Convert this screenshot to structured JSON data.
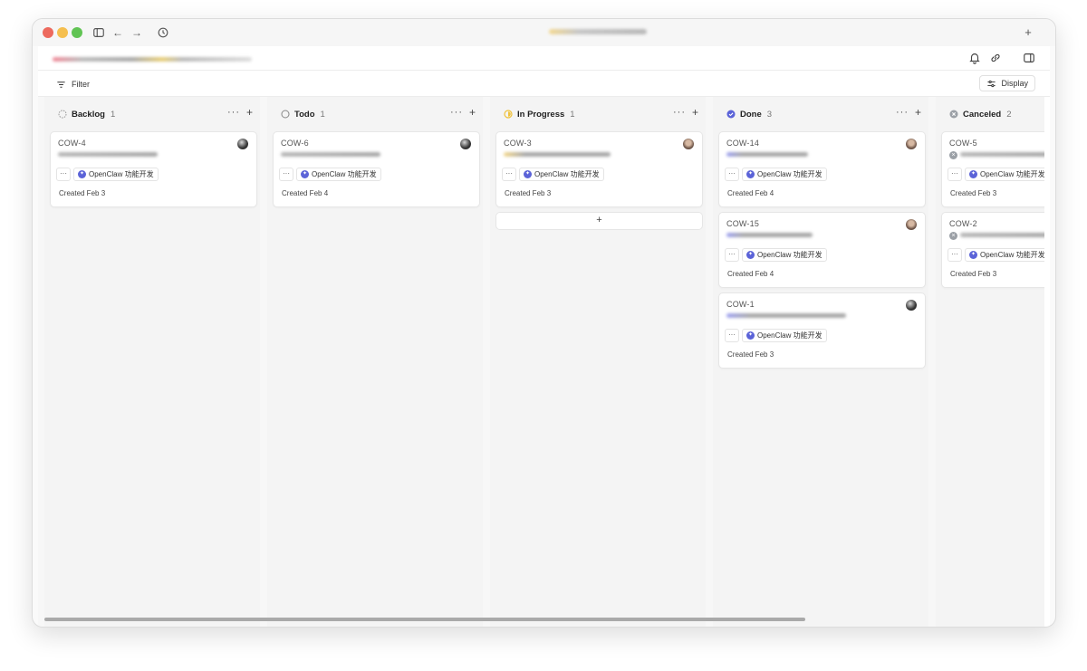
{
  "window": {
    "colors": {
      "close": "#ed6a5e",
      "minimize": "#f5bf4f",
      "zoom": "#61c454"
    }
  },
  "toolbar": {
    "filter_label": "Filter",
    "display_label": "Display"
  },
  "columns": [
    {
      "title": "Backlog",
      "count": "1",
      "status": "backlog-icon",
      "cards": [
        {
          "id": "COW-4",
          "project": "OpenClaw 功能开发",
          "created": "Created Feb 3"
        }
      ]
    },
    {
      "title": "Todo",
      "count": "1",
      "status": "todo-icon",
      "cards": [
        {
          "id": "COW-6",
          "project": "OpenClaw 功能开发",
          "created": "Created Feb 4"
        }
      ]
    },
    {
      "title": "In Progress",
      "count": "1",
      "status": "in-progress-icon",
      "cards": [
        {
          "id": "COW-3",
          "project": "OpenClaw 功能开发",
          "created": "Created Feb 3"
        }
      ],
      "add_label": "+"
    },
    {
      "title": "Done",
      "count": "3",
      "status": "done-icon",
      "cards": [
        {
          "id": "COW-14",
          "project": "OpenClaw 功能开发",
          "created": "Created Feb 4"
        },
        {
          "id": "COW-15",
          "project": "OpenClaw 功能开发",
          "created": "Created Feb 4"
        },
        {
          "id": "COW-1",
          "project": "OpenClaw 功能开发",
          "created": "Created Feb 3"
        }
      ]
    },
    {
      "title": "Canceled",
      "count": "2",
      "status": "canceled-icon",
      "cards": [
        {
          "id": "COW-5",
          "project": "OpenClaw 功能开发",
          "created": "Created Feb 3"
        },
        {
          "id": "COW-2",
          "project": "OpenClaw 功能开发",
          "created": "Created Feb 3"
        }
      ]
    }
  ],
  "common": {
    "more": "···",
    "add": "+"
  },
  "accent_colors": {
    "done": "#5b63d8",
    "in_progress": "#f0c23b",
    "canceled": "#9ba0a6"
  }
}
